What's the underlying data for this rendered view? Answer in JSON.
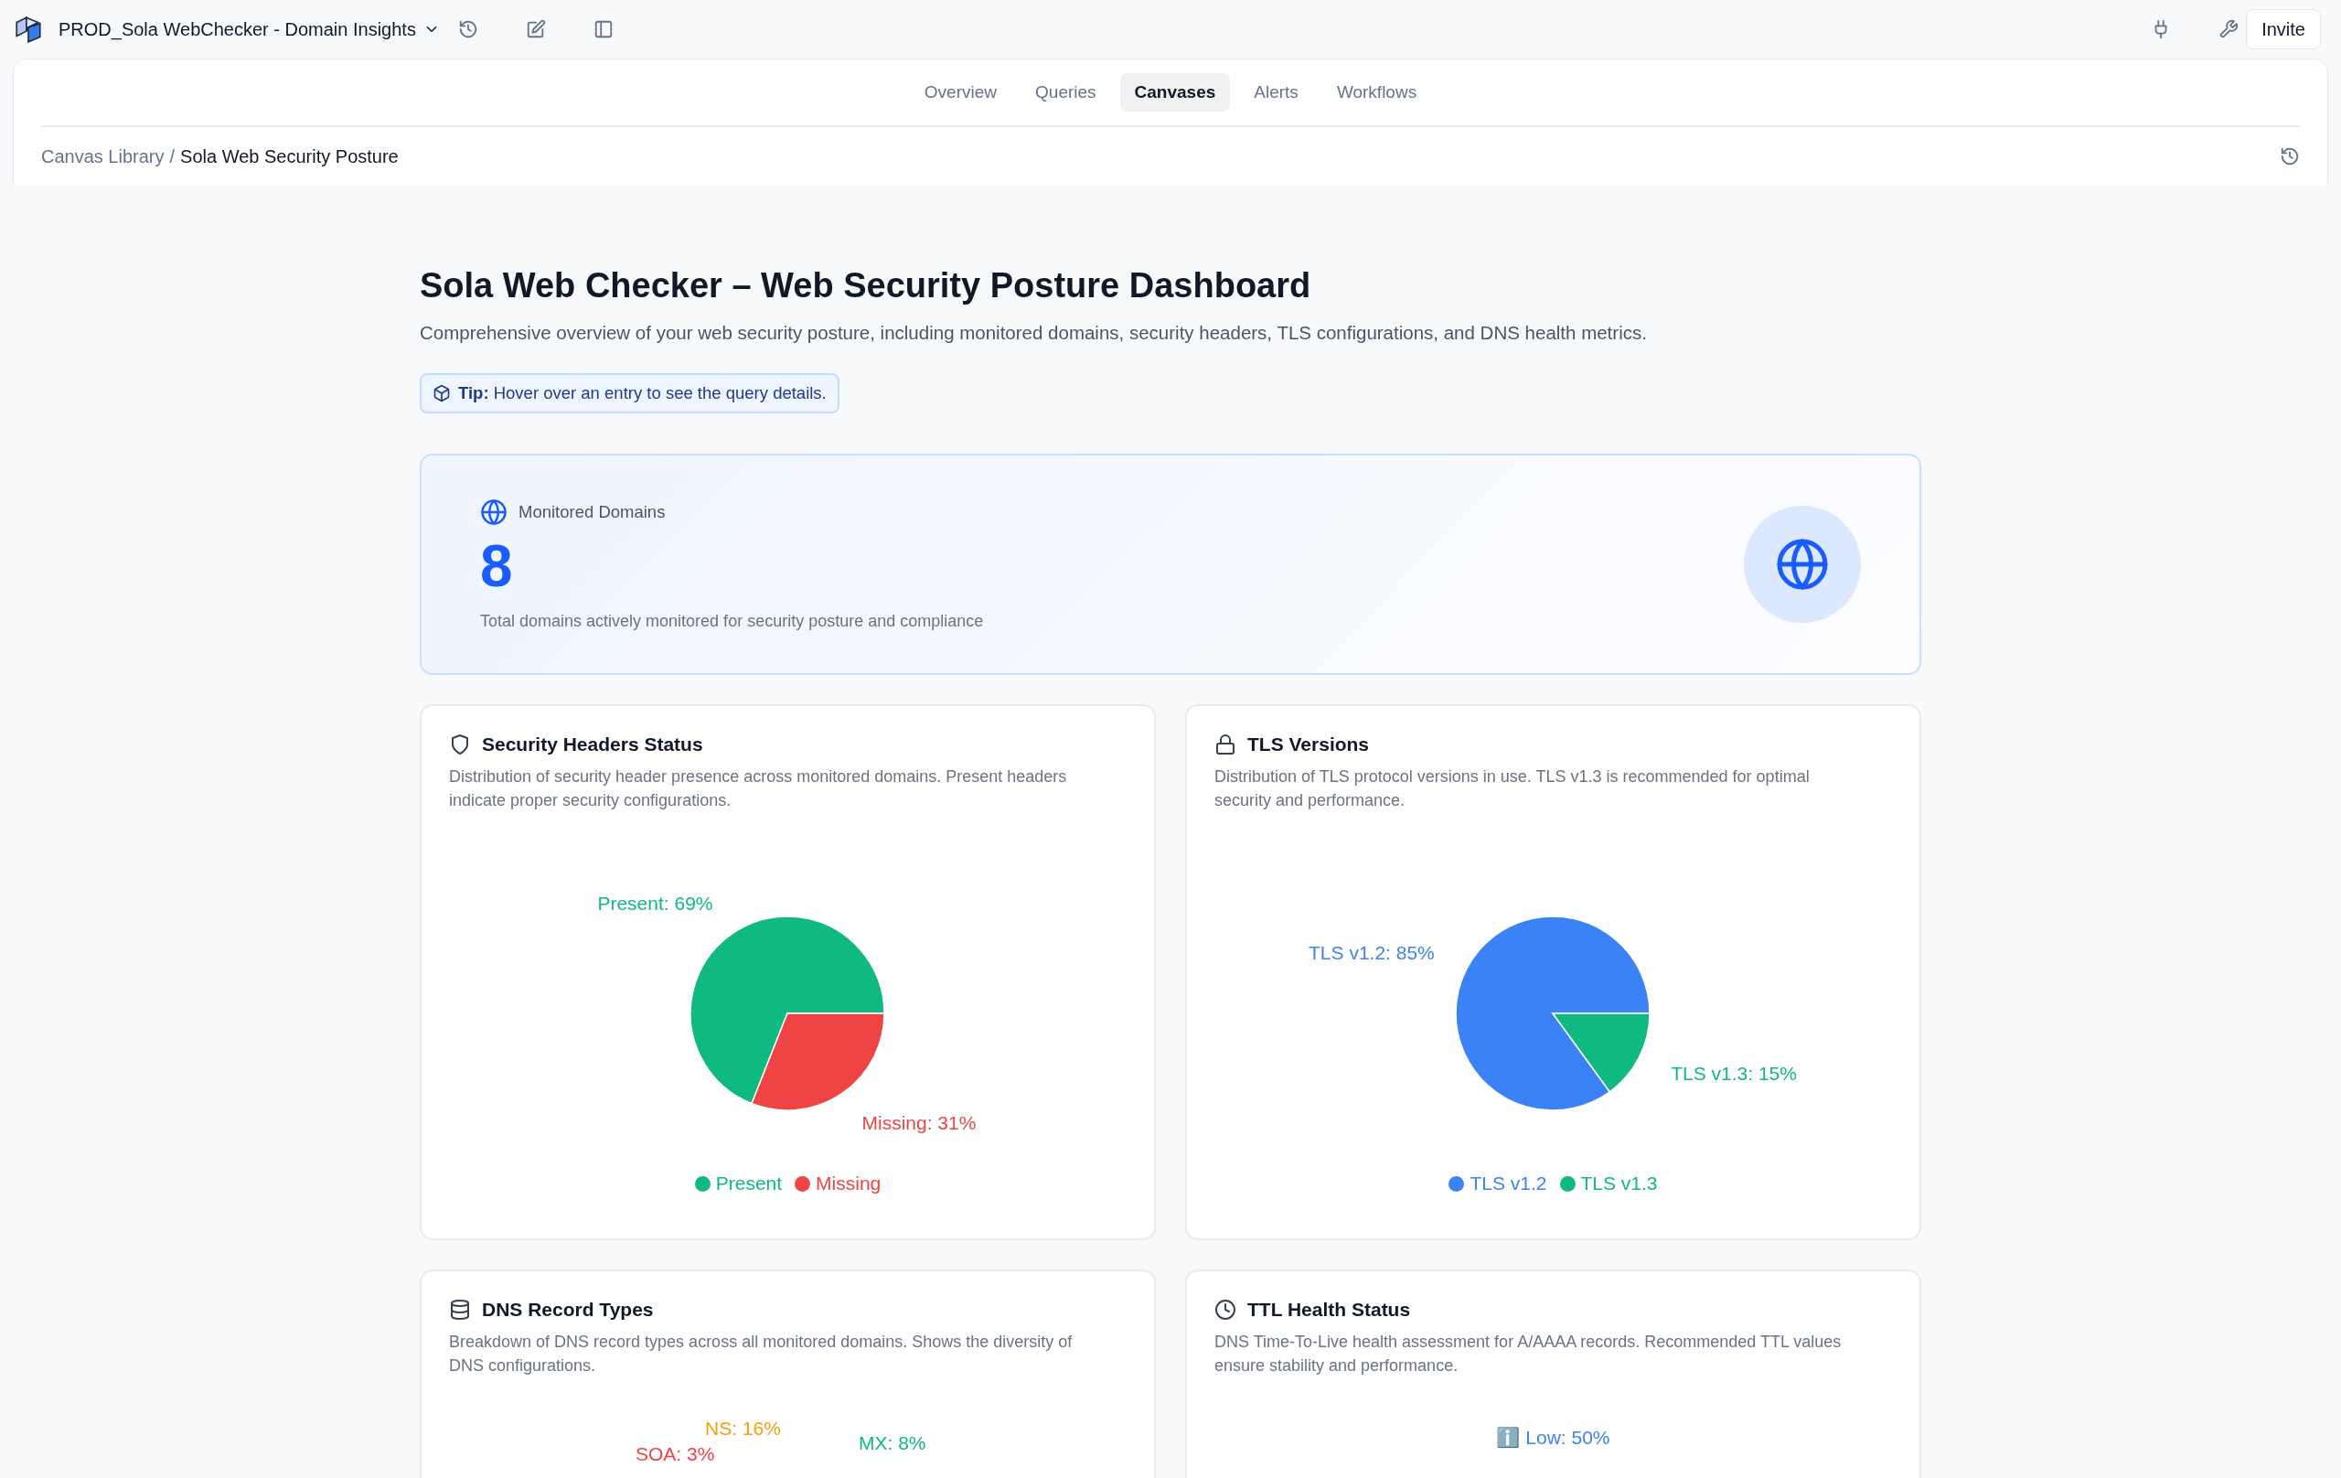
{
  "topbar": {
    "title": "PROD_Sola WebChecker - Domain Insights",
    "invite": "Invite"
  },
  "tabs": [
    {
      "label": "Overview",
      "selected": false
    },
    {
      "label": "Queries",
      "selected": false
    },
    {
      "label": "Canvases",
      "selected": true
    },
    {
      "label": "Alerts",
      "selected": false
    },
    {
      "label": "Workflows",
      "selected": false
    }
  ],
  "breadcrumb": {
    "parent": "Canvas Library",
    "separator": "/",
    "current": "Sola Web Security Posture"
  },
  "page": {
    "title": "Sola Web Checker – Web Security Posture Dashboard",
    "subtitle": "Comprehensive overview of your web security posture, including monitored domains, security headers, TLS configurations, and DNS health metrics.",
    "tip": "**Tip:** Hover over an entry to see the query details."
  },
  "metric": {
    "label": "Monitored Domains",
    "value": "8",
    "caption": "Total domains actively monitored for security posture and compliance"
  },
  "cards": [
    {
      "kind": "pie",
      "title": "Security Headers Status",
      "description": "Distribution of security header presence across monitored domains. Present headers indicate proper security configurations.",
      "chart_data": {
        "type": "pie",
        "categories": [
          "Present",
          "Missing"
        ],
        "values": [
          69,
          31
        ],
        "colors": [
          "#10b981",
          "#ef4444"
        ],
        "value_labels": [
          "Present: 69%",
          "Missing: 31%"
        ],
        "legend": "bottom"
      }
    },
    {
      "kind": "pie",
      "title": "TLS Versions",
      "description": "Distribution of TLS protocol versions in use. TLS v1.3 is recommended for optimal security and performance.",
      "chart_data": {
        "type": "pie",
        "categories": [
          "TLS v1.2",
          "TLS v1.3"
        ],
        "values": [
          85,
          15
        ],
        "colors": [
          "#3b82f6",
          "#10b981"
        ],
        "value_labels": [
          "TLS v1.2: 85%",
          "TLS v1.3: 15%"
        ],
        "legend": "bottom"
      }
    },
    {
      "kind": "cut",
      "title": "DNS Record Types",
      "description": "Breakdown of DNS record types across all monitored domains. Shows the diversity of DNS configurations.",
      "labels": [
        {
          "text": "NS: 16%",
          "color": "#f59e0b"
        },
        {
          "text": "MX: 8%",
          "color": "#10b981"
        },
        {
          "text": "SOA: 3%",
          "color": "#ef4444"
        }
      ]
    },
    {
      "kind": "cut",
      "title": "TTL Health Status",
      "description": "DNS Time-To-Live health assessment for A/AAAA records. Recommended TTL values ensure stability and performance.",
      "labels": [
        {
          "text": "ℹ️ Low: 50%",
          "color": "#3b82f6"
        }
      ]
    }
  ]
}
